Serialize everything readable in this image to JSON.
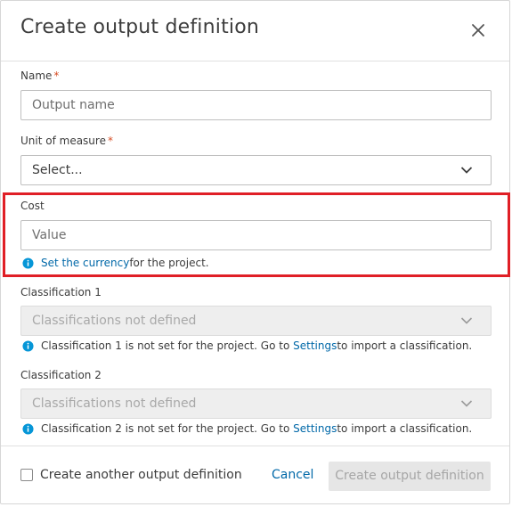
{
  "dialog": {
    "title": "Create output definition"
  },
  "fields": {
    "name": {
      "label": "Name",
      "required_mark": "*",
      "placeholder": "Output name"
    },
    "unit": {
      "label": "Unit of measure",
      "required_mark": "*",
      "value": "Select..."
    },
    "cost": {
      "label": "Cost",
      "placeholder": "Value",
      "info_link": "Set the currency",
      "info_text": " for the project."
    },
    "classification1": {
      "label": "Classification 1",
      "value": "Classifications not defined",
      "info_text_before": "Classification 1 is not set for the project. Go to ",
      "info_link": "Settings",
      "info_text_after": " to import a classification."
    },
    "classification2": {
      "label": "Classification 2",
      "value": "Classifications not defined",
      "info_text_before": "Classification 2 is not set for the project. Go to ",
      "info_link": "Settings",
      "info_text_after": " to import a classification."
    }
  },
  "footer": {
    "checkbox_label": "Create another output definition",
    "cancel_label": "Cancel",
    "create_label": "Create output definition"
  },
  "colors": {
    "link": "#0068a8",
    "required": "#d74e26",
    "highlight": "#e01f26",
    "info_icon": "#0696d7"
  }
}
